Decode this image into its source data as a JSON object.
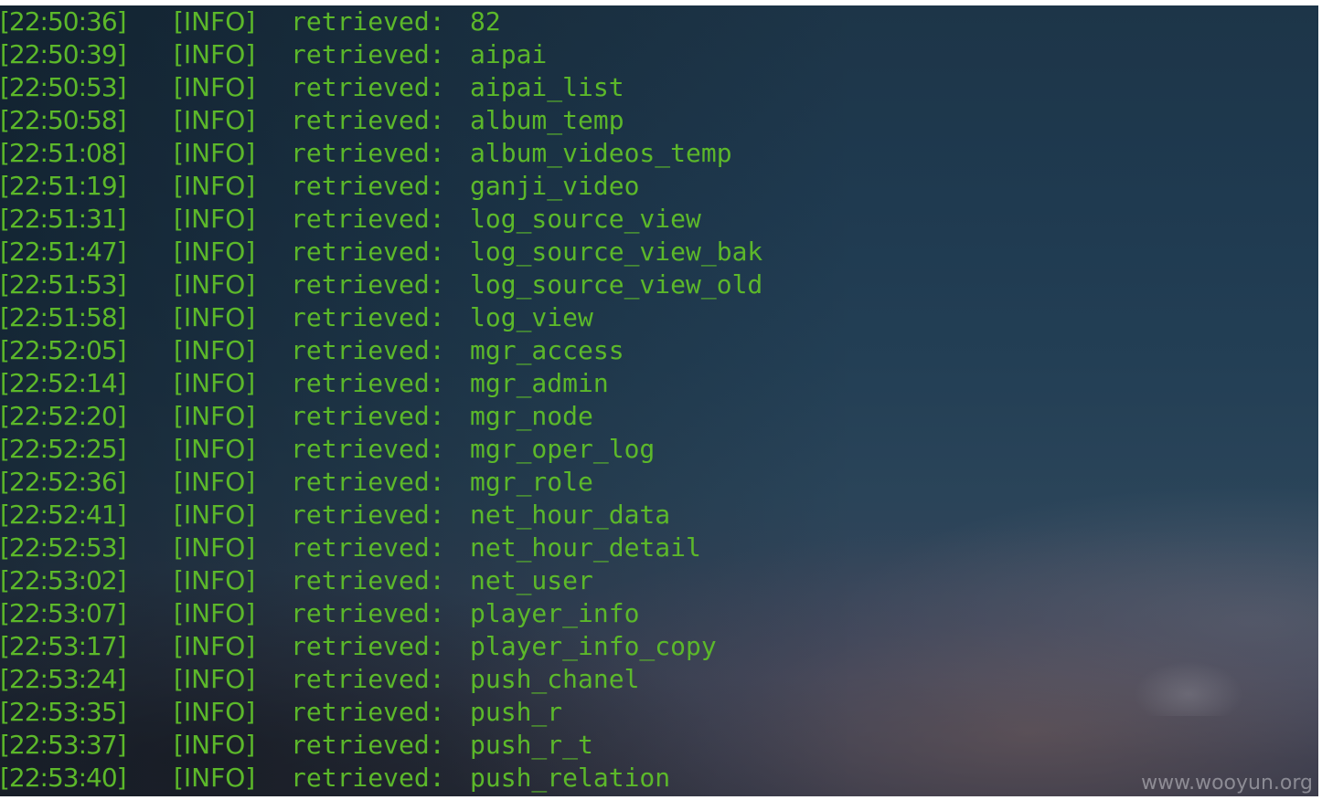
{
  "terminal": {
    "lines": [
      {
        "time": "[22:50:36]",
        "level": "[INFO]",
        "message": "retrieved:",
        "value": "82"
      },
      {
        "time": "[22:50:39]",
        "level": "[INFO]",
        "message": "retrieved:",
        "value": "aipai"
      },
      {
        "time": "[22:50:53]",
        "level": "[INFO]",
        "message": "retrieved:",
        "value": "aipai_list"
      },
      {
        "time": "[22:50:58]",
        "level": "[INFO]",
        "message": "retrieved:",
        "value": "album_temp"
      },
      {
        "time": "[22:51:08]",
        "level": "[INFO]",
        "message": "retrieved:",
        "value": "album_videos_temp"
      },
      {
        "time": "[22:51:19]",
        "level": "[INFO]",
        "message": "retrieved:",
        "value": "ganji_video"
      },
      {
        "time": "[22:51:31]",
        "level": "[INFO]",
        "message": "retrieved:",
        "value": "log_source_view"
      },
      {
        "time": "[22:51:47]",
        "level": "[INFO]",
        "message": "retrieved:",
        "value": "log_source_view_bak"
      },
      {
        "time": "[22:51:53]",
        "level": "[INFO]",
        "message": "retrieved:",
        "value": "log_source_view_old"
      },
      {
        "time": "[22:51:58]",
        "level": "[INFO]",
        "message": "retrieved:",
        "value": "log_view"
      },
      {
        "time": "[22:52:05]",
        "level": "[INFO]",
        "message": "retrieved:",
        "value": "mgr_access"
      },
      {
        "time": "[22:52:14]",
        "level": "[INFO]",
        "message": "retrieved:",
        "value": "mgr_admin"
      },
      {
        "time": "[22:52:20]",
        "level": "[INFO]",
        "message": "retrieved:",
        "value": "mgr_node"
      },
      {
        "time": "[22:52:25]",
        "level": "[INFO]",
        "message": "retrieved:",
        "value": "mgr_oper_log"
      },
      {
        "time": "[22:52:36]",
        "level": "[INFO]",
        "message": "retrieved:",
        "value": "mgr_role"
      },
      {
        "time": "[22:52:41]",
        "level": "[INFO]",
        "message": "retrieved:",
        "value": "net_hour_data"
      },
      {
        "time": "[22:52:53]",
        "level": "[INFO]",
        "message": "retrieved:",
        "value": "net_hour_detail"
      },
      {
        "time": "[22:53:02]",
        "level": "[INFO]",
        "message": "retrieved:",
        "value": "net_user"
      },
      {
        "time": "[22:53:07]",
        "level": "[INFO]",
        "message": "retrieved:",
        "value": "player_info"
      },
      {
        "time": "[22:53:17]",
        "level": "[INFO]",
        "message": "retrieved:",
        "value": "player_info_copy"
      },
      {
        "time": "[22:53:24]",
        "level": "[INFO]",
        "message": "retrieved:",
        "value": "push_chanel"
      },
      {
        "time": "[22:53:35]",
        "level": "[INFO]",
        "message": "retrieved:",
        "value": "push_r"
      },
      {
        "time": "[22:53:37]",
        "level": "[INFO]",
        "message": "retrieved:",
        "value": "push_r_t"
      },
      {
        "time": "[22:53:40]",
        "level": "[INFO]",
        "message": "retrieved:",
        "value": "push_relation"
      }
    ]
  },
  "watermark": "www.wooyun.org",
  "colors": {
    "text": "#5cb82a",
    "background_top": "#1d3548",
    "background_bottom": "#2e3341"
  }
}
